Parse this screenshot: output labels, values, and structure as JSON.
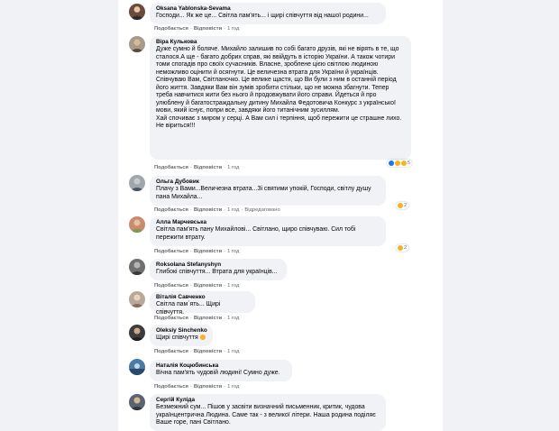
{
  "comments": [
    {
      "author": "Oksana Yablonska-Sevama",
      "text": "Господи... Як же це... Світла пам'ять... і щирі співчуття від нашої родини...",
      "like": "Подобається",
      "reply": "Відповісти",
      "time": "1 год"
    },
    {
      "author": "Віра Кулькова",
      "text": "Дуже сумно й боляче. Михайло залишив по собі багато друзів, які не вірять в те, що сталося.А ще - багато добрих справ, які ввійдуть в історію України. А також чотири томи спогадів про своїх сучасників. Власне, зроблене цією світлою людиною неможливо оцінити й осягнути. Це величезна втрата для України й українців.\nСпівчуваю Вам, Світланочко. Це велике щастя, що Ви були з ним в останній період його життя. Завдяки Вам він зумів зробити стільки, що не можна збагнути. Тепер треба навчитися жити без нього й продовжувати його справи. Йдеться й про улюблену й багатостраждальну дитину Михайла Федотовича Конкурс з української мови, який існує, попри все, завдяки його титанічним зусиллям.\nХай спочиває з миром у серці. А Вам сил і терпіння, щоб пережити це страшне лихо. Не віриться!!!",
      "like": "Подобається",
      "reply": "Відповісти",
      "time": "1 год",
      "reaction_count": "5"
    },
    {
      "author": "Ольга Дубовик",
      "text": "Плачу з Вами...Величезна втрата...Зі святими упокій, Господи, світлу душу пана Михайла...",
      "like": "Подобається",
      "reply": "Відповісти",
      "time": "1 год",
      "extra": "Відредаговано",
      "reaction_count": "2"
    },
    {
      "author": "Алла Марчевська",
      "text": "Світла пам'ять пану Михайлові... Світлано, щиро співчуваю. Сил тобі пережити втрату.",
      "like": "Подобається",
      "reply": "Відповісти",
      "time": "1 год",
      "reaction_count": "2"
    },
    {
      "author": "Roksolana Stefanyshyn",
      "text": "Глибокі співчуття... Втрата для українців...",
      "like": "Подобається",
      "reply": "Відповісти",
      "time": "1 год"
    },
    {
      "author": "Віталія Савченко",
      "text": "Світла пам`ять... Щирі співчуття.",
      "like": "Подобається",
      "reply": "Відповісти",
      "time": "1 год"
    },
    {
      "author": "Oleksiy Sinchenko",
      "text": "Щирі співчуття",
      "like": "Подобається",
      "reply": "Відповісти",
      "time": "1 год"
    },
    {
      "author": "Наталія Коцюбинська",
      "text": "Вічна пам'ять чудовій людині! Сумно дуже.",
      "like": "Подобається",
      "reply": "Відповісти",
      "time": "1 год"
    },
    {
      "author": "Сергій Куліда",
      "text": "Безмежний сум... Пішов у засвіти визначний письменник, критик, чудова українцентрична Людина. Саме так - з великої літери. Наша родина поділяє Ваше горе, пані Світлано.",
      "like": "Подобається",
      "reply": "Відповісти",
      "time": "1 год"
    }
  ],
  "colors": {
    "bubble": "#f0f2f5",
    "muted": "#65676b",
    "like": "#1877f2",
    "emoji": "#f7b125"
  }
}
